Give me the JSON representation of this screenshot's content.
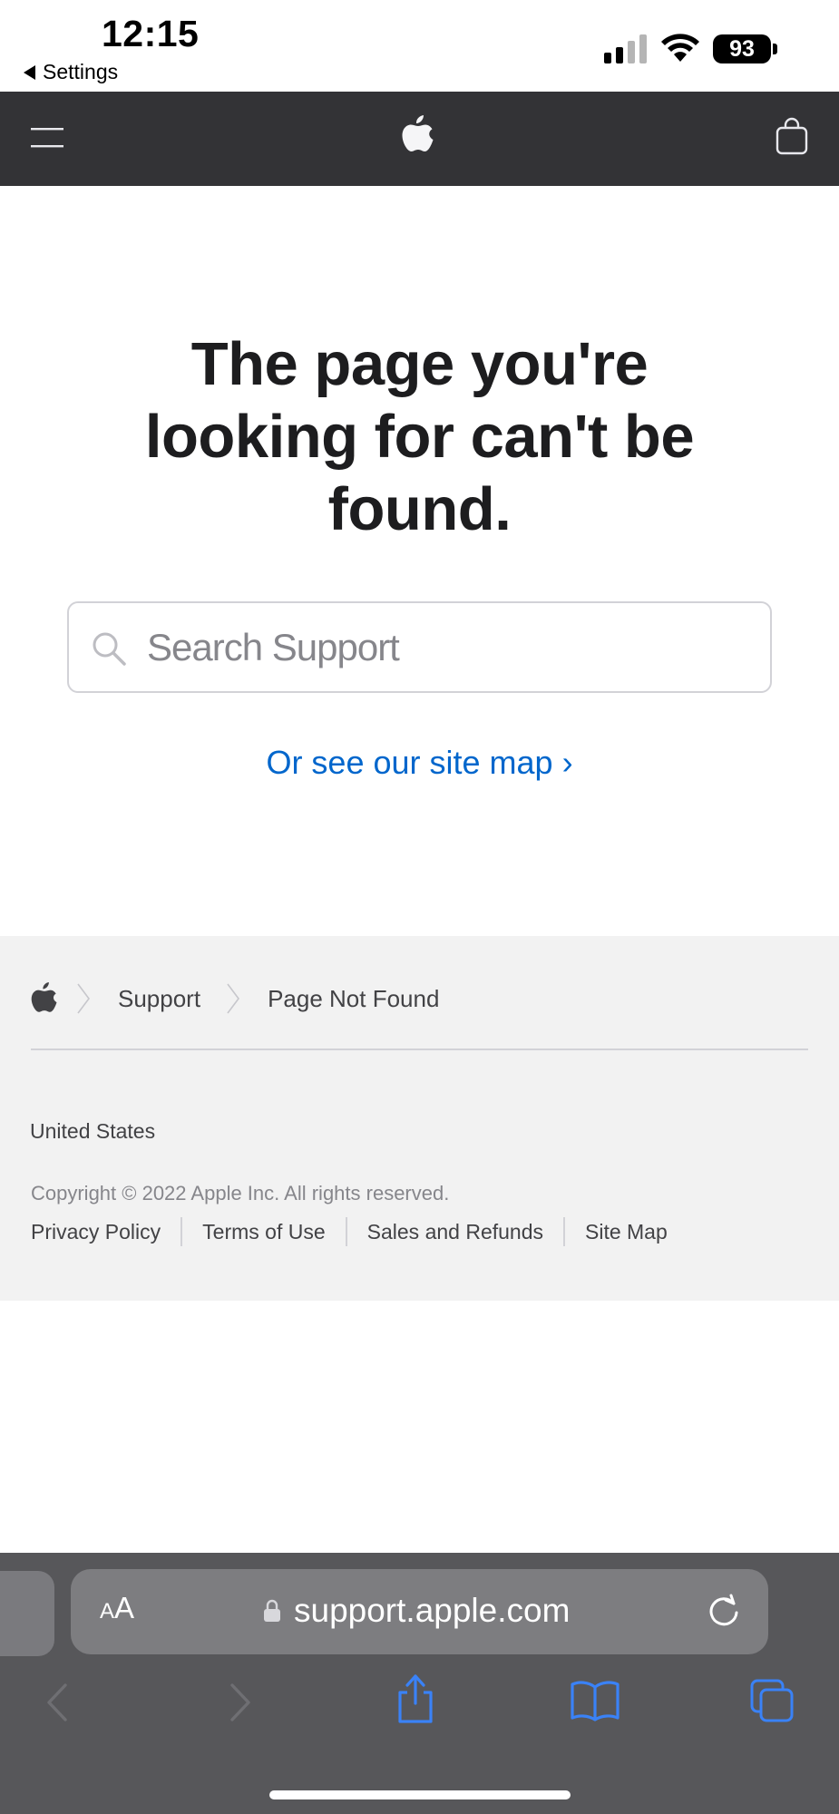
{
  "status_bar": {
    "time": "12:15",
    "back_label": "Settings",
    "battery": "93"
  },
  "main": {
    "headline": "The page you're looking for can't be found.",
    "search_placeholder": "Search Support",
    "sitemap_link": "Or see our site map ›"
  },
  "footer": {
    "breadcrumbs": [
      "Support",
      "Page Not Found"
    ],
    "country": "United States",
    "copyright": "Copyright © 2022 Apple Inc. All rights reserved.",
    "legal_links": [
      "Privacy Policy",
      "Terms of Use",
      "Sales and Refunds",
      "Site Map"
    ]
  },
  "safari": {
    "text_size_label_small": "A",
    "text_size_label_large": "A",
    "url": "support.apple.com"
  },
  "colors": {
    "nav_bg": "#333336",
    "link": "#0066cc",
    "footer_bg": "#f2f2f2",
    "safari_bar": "#57575a",
    "toolbar_icon": "#3a82f7"
  }
}
